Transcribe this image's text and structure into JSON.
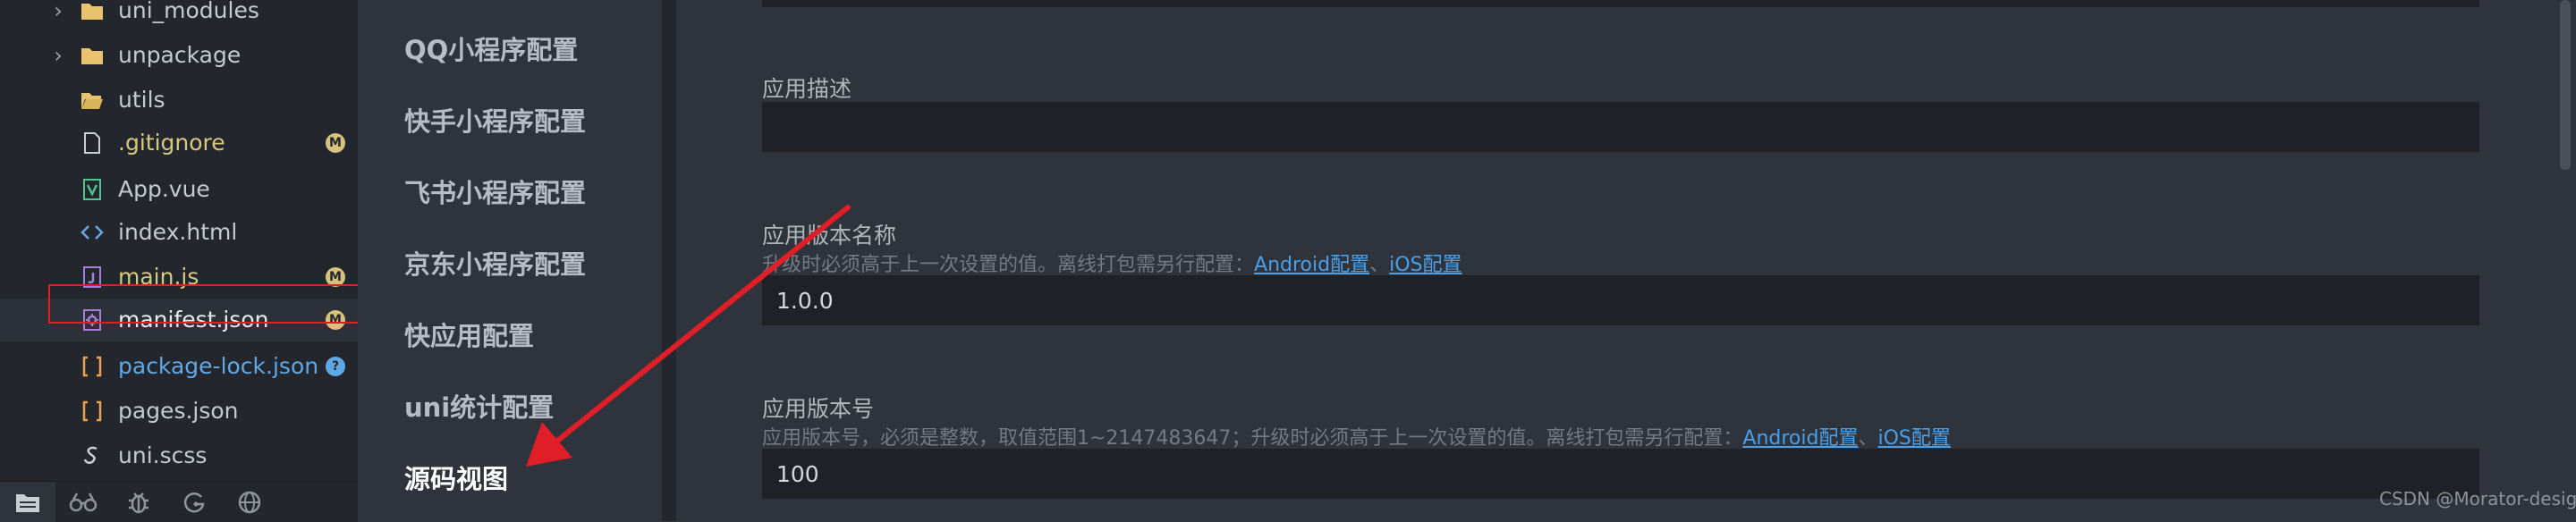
{
  "explorer": {
    "items": [
      {
        "name": "uni_modules",
        "type": "folder",
        "expandable": true,
        "color": "#c5cad1",
        "badge": ""
      },
      {
        "name": "unpackage",
        "type": "folder",
        "expandable": true,
        "color": "#c5cad1",
        "badge": ""
      },
      {
        "name": "utils",
        "type": "folder-open",
        "expandable": false,
        "color": "#c5cad1",
        "badge": ""
      },
      {
        "name": ".gitignore",
        "type": "file",
        "expandable": false,
        "color": "#d8c77e",
        "badge": "M"
      },
      {
        "name": "App.vue",
        "type": "vue",
        "expandable": false,
        "color": "#c5cad1",
        "badge": ""
      },
      {
        "name": "index.html",
        "type": "html",
        "expandable": false,
        "color": "#c5cad1",
        "badge": ""
      },
      {
        "name": "main.js",
        "type": "js",
        "expandable": false,
        "color": "#d8c77e",
        "badge": "M"
      },
      {
        "name": "manifest.json",
        "type": "gear-json",
        "expandable": false,
        "color": "#e6e9ed",
        "badge": "M"
      },
      {
        "name": "package-lock.json",
        "type": "json",
        "expandable": false,
        "color": "#5fa8e6",
        "badge": "?"
      },
      {
        "name": "pages.json",
        "type": "json",
        "expandable": false,
        "color": "#c5cad1",
        "badge": ""
      },
      {
        "name": "uni.scss",
        "type": "scss",
        "expandable": false,
        "color": "#c5cad1",
        "badge": ""
      }
    ]
  },
  "nav": {
    "items": [
      {
        "label": "QQ小程序配置",
        "active": false
      },
      {
        "label": "快手小程序配置",
        "active": false
      },
      {
        "label": "飞书小程序配置",
        "active": false
      },
      {
        "label": "京东小程序配置",
        "active": false
      },
      {
        "label": "快应用配置",
        "active": false
      },
      {
        "label": "uni统计配置",
        "active": false
      },
      {
        "label": "源码视图",
        "active": true
      }
    ]
  },
  "form": {
    "description": {
      "label": "应用描述",
      "value": ""
    },
    "version_name": {
      "label": "应用版本名称",
      "help": "升级时必须高于上一次设置的值。离线打包需另行配置：",
      "android_link": "Android配置",
      "separator": "、",
      "ios_link": "iOS配置",
      "value": "1.0.0"
    },
    "version_code": {
      "label": "应用版本号",
      "help": "应用版本号，必须是整数，取值范围1~2147483647；升级时必须高于上一次设置的值。离线打包需另行配置：",
      "android_link": "Android配置",
      "separator": "、",
      "ios_link": "iOS配置",
      "value": "100"
    }
  },
  "watermark": "CSDN @Morator-design",
  "colors": {
    "annotation_red": "#e01e28",
    "link_blue": "#4a9fe9",
    "badge_modified": "#d6c27a",
    "badge_untracked": "#5fa8e6"
  }
}
